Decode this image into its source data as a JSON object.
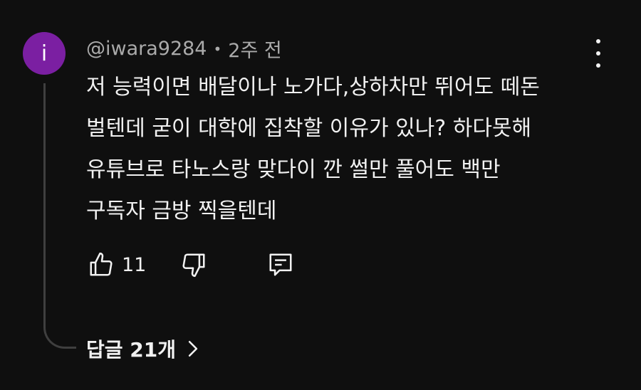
{
  "comment": {
    "avatar_letter": "i",
    "avatar_color": "#7b1fa2",
    "author": "@iwara9284",
    "separator": "•",
    "time": "2주 전",
    "text_lines": [
      "저 능력이면 배달이나 노가다,상하차만 뛰어도 떼돈",
      "벌텐데 굳이 대학에 집착할 이유가 있나? 하다못해",
      "유튜브로 타노스랑 맞다이 깐 썰만 풀어도 백만",
      "구독자 금방 찍을텐데"
    ],
    "likes": "11",
    "replies_label": "답글 21개"
  },
  "icons": {
    "like": "thumbs-up-icon",
    "dislike": "thumbs-down-icon",
    "reply": "reply-comment-icon",
    "more": "more-vertical-icon",
    "chevron": "chevron-right-icon"
  },
  "colors": {
    "background": "#0f0f0f",
    "text": "#f1f1f1",
    "meta_text": "#aaaaaa",
    "thread_line": "#3f3f3f"
  }
}
